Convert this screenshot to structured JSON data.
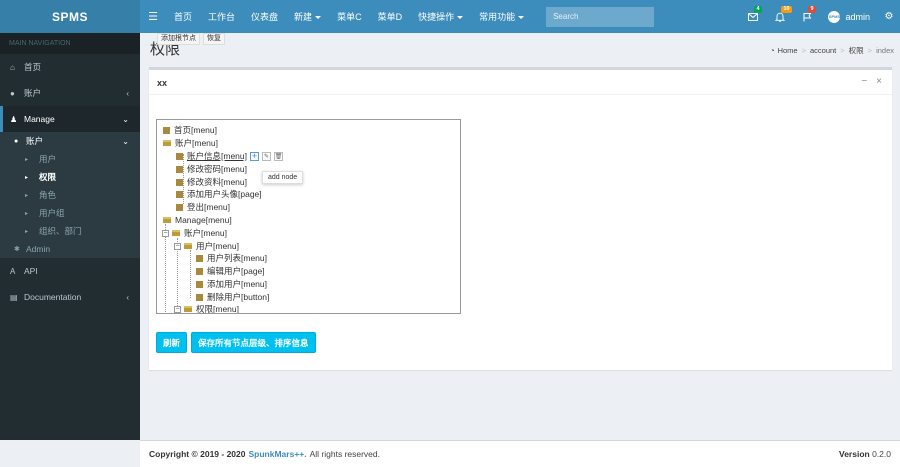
{
  "brand": "SPMS",
  "navbar": {
    "items": [
      {
        "label": "首页",
        "dropdown": false
      },
      {
        "label": "工作台",
        "dropdown": false
      },
      {
        "label": "仪表盘",
        "dropdown": false
      },
      {
        "label": "新建",
        "dropdown": true
      },
      {
        "label": "菜单C",
        "dropdown": false
      },
      {
        "label": "菜单D",
        "dropdown": false
      },
      {
        "label": "快捷操作",
        "dropdown": true
      },
      {
        "label": "常用功能",
        "dropdown": true
      }
    ],
    "search_placeholder": "Search",
    "badges": {
      "messages": "4",
      "notifications": "10",
      "tasks": "9"
    },
    "user_name": "admin",
    "avatar_text": "SPMS"
  },
  "sidebar": {
    "header": "MAIN NAVIGATION",
    "items": [
      {
        "label": "首页",
        "icon": "home-icon"
      },
      {
        "label": "账户",
        "icon": "user-icon"
      },
      {
        "label": "Manage",
        "icon": "users-cog-icon"
      }
    ],
    "manage_sub": {
      "label": "账户",
      "children": [
        "用户",
        "权限",
        "角色",
        "用户组",
        "组织、部门"
      ]
    },
    "admin": "Admin",
    "bottom": [
      "API",
      "Documentation"
    ]
  },
  "content": {
    "title": "权限",
    "breadcrumb": [
      "Home",
      "account",
      "权限",
      "index"
    ]
  },
  "box": {
    "title": "xx",
    "btn_add_root": "添加根节点",
    "btn_restore": "恢复",
    "tooltip": "add node",
    "btn_refresh": "刷新",
    "btn_save": "保存所有节点层级、排序信息"
  },
  "tree": [
    "首页[menu]",
    "账户[menu]",
    "账户信息[menu]",
    "修改密码[menu]",
    "修改资料[menu]",
    "添加用户头像[page]",
    "登出[menu]",
    "Manage[menu]",
    "账户[menu]",
    "用户[menu]",
    "用户列表[menu]",
    "编辑用户[page]",
    "添加用户[menu]",
    "删除用户[button]",
    "权限[menu]"
  ],
  "footer": {
    "copyright": "Copyright © 2019 - 2020",
    "brand": "SpunkMars++.",
    "rights": "All rights reserved.",
    "version_label": "Version",
    "version": "0.2.0"
  }
}
